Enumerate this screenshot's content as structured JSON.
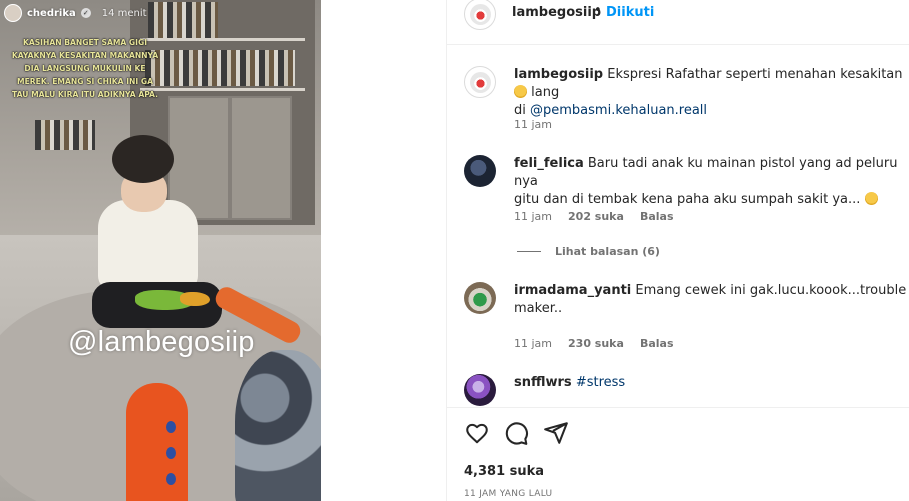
{
  "video": {
    "story_user": "chedrika",
    "story_time": "14 menit",
    "caption_overlay": "Kasihan banget sama Gigi kayaknya kesakitan makannya dia langsung mukulin ke merek. Emang si chika ini ga tau malu kira itu adiknya apa.",
    "watermark": "@lambegosiip"
  },
  "post": {
    "header": {
      "username": "lambegosiip",
      "separator": "•",
      "follow_label": "Diikuti"
    },
    "caption": {
      "username": "lambegosiip",
      "text": "Ekspresi Rafathar seperti menahan kesakitan",
      "text_tail": "lang",
      "line2_prefix": "di",
      "mention": "@pembasmi.kehaluan.reall",
      "time": "11 jam"
    },
    "comments": [
      {
        "username": "feli_felica",
        "text_line1": "Baru tadi anak ku mainan pistol yang ad peluru nya",
        "text_line2": "gitu dan di tembak kena paha aku sumpah sakit ya...",
        "time": "11 jam",
        "likes": "202 suka",
        "reply": "Balas",
        "view_replies": "Lihat balasan (6)"
      },
      {
        "username": "irmadama_yanti",
        "text_line1": "Emang cewek ini gak.lucu.koook...trouble",
        "text_line2": "maker..",
        "time": "11 jam",
        "likes": "230 suka",
        "reply": "Balas"
      },
      {
        "username": "snfflwrs",
        "hashtag": "#stress"
      }
    ],
    "like_count": "4,381 suka",
    "posted_ago": "11 JAM YANG LALU"
  },
  "icons": [
    "heart-icon",
    "comment-icon",
    "share-icon"
  ],
  "colors": {
    "link_blue": "#0095f6",
    "mention": "#00376b",
    "secondary_text": "#737373"
  }
}
